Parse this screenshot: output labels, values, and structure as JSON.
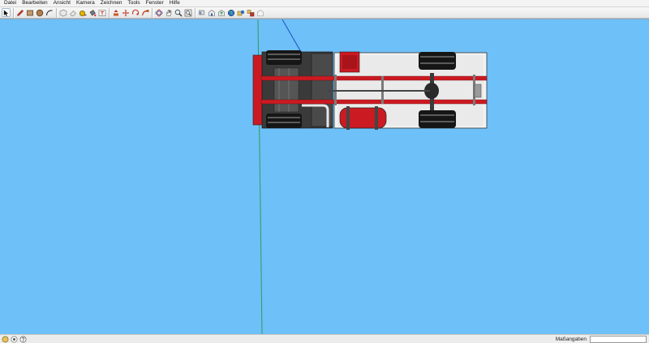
{
  "menu": {
    "items": [
      {
        "label": "Datei"
      },
      {
        "label": "Bearbeiten"
      },
      {
        "label": "Ansicht"
      },
      {
        "label": "Kamera"
      },
      {
        "label": "Zeichnen"
      },
      {
        "label": "Tools"
      },
      {
        "label": "Fenster"
      },
      {
        "label": "Hilfe"
      }
    ]
  },
  "toolbar": {
    "tools": [
      {
        "icon": "select-arrow-icon",
        "active": true
      },
      {
        "icon": "pencil-icon"
      },
      {
        "icon": "rectangle-icon"
      },
      {
        "icon": "circle-icon"
      },
      {
        "icon": "arc-icon"
      },
      {
        "icon": "make-component-icon"
      },
      {
        "icon": "eraser-icon"
      },
      {
        "icon": "tape-measure-icon"
      },
      {
        "icon": "paint-bucket-icon"
      },
      {
        "icon": "text-icon"
      },
      {
        "icon": "push-pull-icon"
      },
      {
        "icon": "move-icon"
      },
      {
        "icon": "rotate-icon"
      },
      {
        "icon": "follow-me-icon"
      },
      {
        "icon": "orbit-icon"
      },
      {
        "icon": "pan-icon"
      },
      {
        "icon": "zoom-icon"
      },
      {
        "icon": "zoom-extents-icon"
      },
      {
        "icon": "previous-view-icon"
      },
      {
        "icon": "3d-warehouse-icon"
      },
      {
        "icon": "share-model-icon"
      },
      {
        "icon": "google-earth-icon"
      },
      {
        "icon": "get-models-icon"
      },
      {
        "icon": "components-icon"
      },
      {
        "icon": "extension-warehouse-icon"
      }
    ]
  },
  "statusbar": {
    "icons": [
      "geo-location-icon",
      "credits-icon",
      "help-icon"
    ],
    "measurements_label": "Maßangaben",
    "measurements_value": ""
  },
  "colors": {
    "sky": "#6ec0f8",
    "truck_red": "#cc1a22",
    "cab_dark": "#3a3a3a",
    "body_white": "#f2f2f2",
    "green_axis": "#2a9d5c",
    "blue_axis": "#1f4fbf"
  }
}
